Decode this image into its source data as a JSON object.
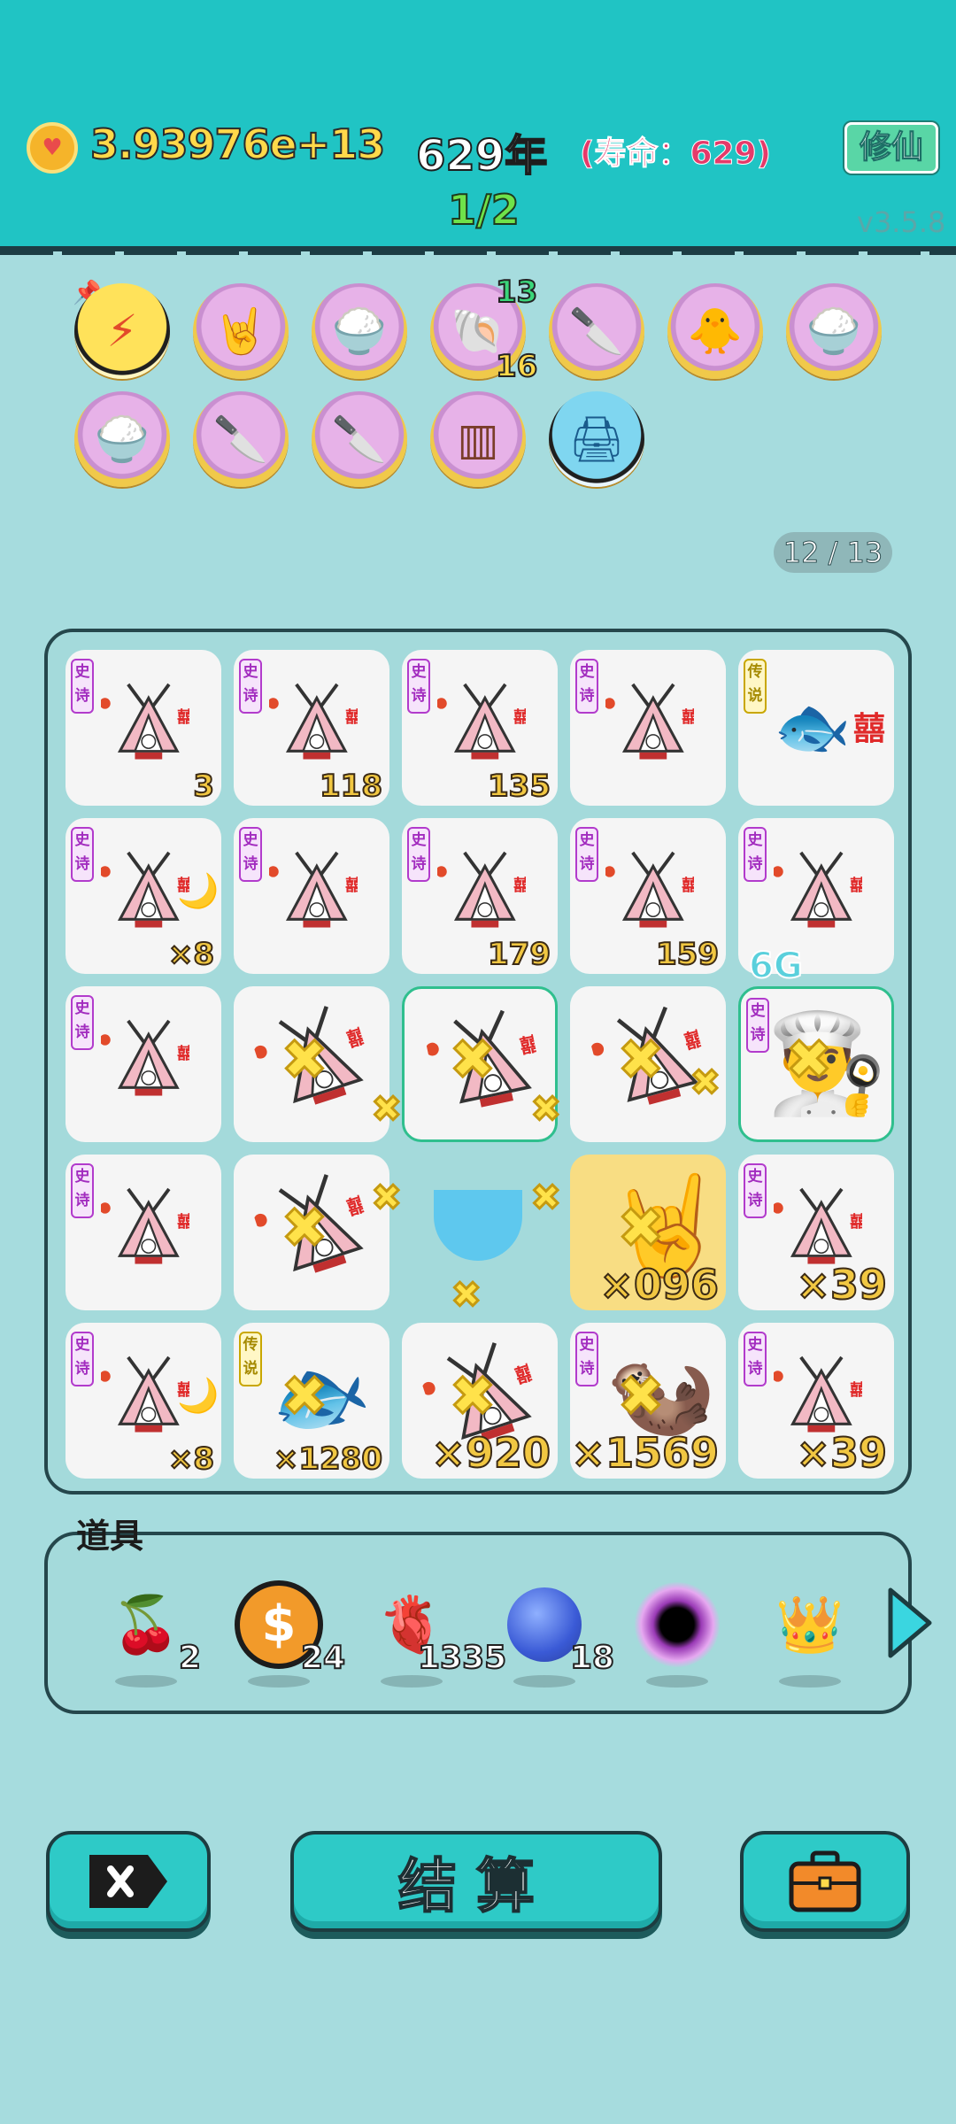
{
  "header": {
    "gold": "3.93976e+13",
    "year": "629年",
    "lifespan": "(寿命：629)",
    "xiuxian_button": "修仙",
    "page": "1/2",
    "version": "v3.5.8"
  },
  "skills": {
    "row1": [
      "thunder-skill-icon",
      "rock-hand-skill-icon",
      "bowls-up-skill-icon",
      "shell-skill-icon",
      "cleaver-skill-icon",
      "chicks-skill-icon",
      "bowls-up-skill-icon"
    ],
    "row2": [
      "bowls-up-skill-icon",
      "cleaver-skill-icon",
      "cleaver-skill-icon",
      "skirt-skill-icon",
      "printer-skill-icon"
    ],
    "shell_top": "13",
    "shell_bottom": "16"
  },
  "page_count": "12 / 13",
  "grid": {
    "tag_epic": "史诗",
    "tag_legend": "传说",
    "counts": {
      "r1c1": "3",
      "r1c2": "118",
      "r1c3": "135",
      "r2c1": "×8",
      "r2c3": "179",
      "r2c4": "159",
      "r4c4": "×096",
      "r4c5": "×39",
      "r5c1": "×8",
      "r5c2": "×1280",
      "r5c3": "×920",
      "r5c4": "×1569",
      "r5c5": "×39"
    },
    "label_6g": "6G"
  },
  "items": {
    "title": "道具",
    "list": [
      {
        "name": "lychee",
        "count": "2"
      },
      {
        "name": "coin",
        "count": "24"
      },
      {
        "name": "liver",
        "count": "1335"
      },
      {
        "name": "blueberry",
        "count": "18"
      },
      {
        "name": "black-hole",
        "count": ""
      },
      {
        "name": "crown",
        "count": ""
      }
    ]
  },
  "buttons": {
    "settle": "结算"
  },
  "colors": {
    "header_bg": "#20c4c4",
    "page_bg": "#a6dcde",
    "gold_text": "#ffd94a",
    "life_text": "#e53a6a",
    "button_bg": "#2ecac7"
  }
}
